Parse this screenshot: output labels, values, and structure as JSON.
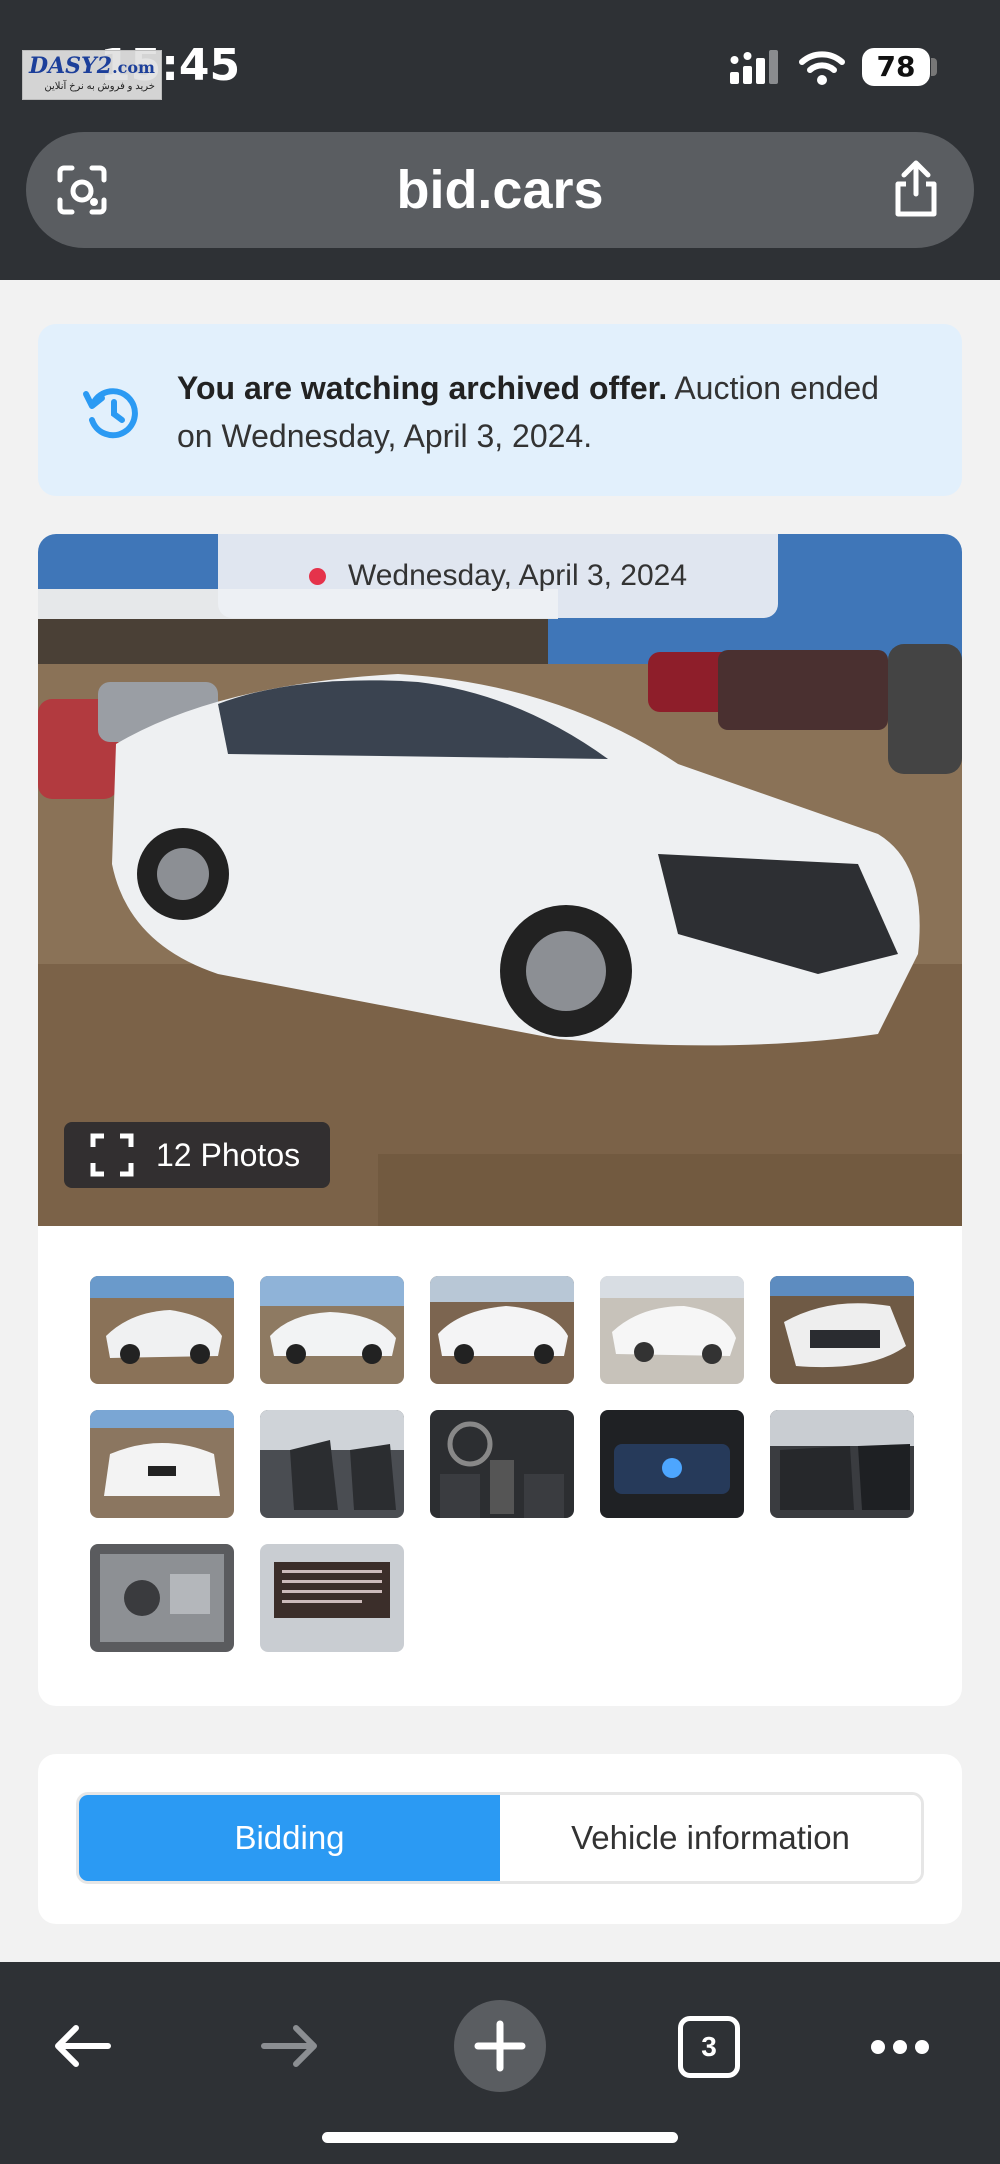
{
  "status_bar": {
    "time": "15:45",
    "battery": "78",
    "watermark": {
      "logo": "DASY2",
      "logo_suffix": ".com",
      "tagline": "خرید و فروش به نرخ آنلاین"
    }
  },
  "url_bar": {
    "domain": "bid.cars",
    "left_icon": "lens-icon",
    "right_icon": "share-icon"
  },
  "notice": {
    "icon": "history-icon",
    "bold": "You are watching archived offer.",
    "text": " Auction ended on Wednesday, April 3, 2024."
  },
  "gallery": {
    "auction_date": "Wednesday, April 3, 2024",
    "photos_label": "12 Photos",
    "thumbnails": [
      {
        "name": "thumb-1",
        "kind": "front-damage"
      },
      {
        "name": "thumb-2",
        "kind": "side"
      },
      {
        "name": "thumb-3",
        "kind": "rear-side"
      },
      {
        "name": "thumb-4",
        "kind": "front-side"
      },
      {
        "name": "thumb-5",
        "kind": "front-close"
      },
      {
        "name": "thumb-6",
        "kind": "rear"
      },
      {
        "name": "thumb-7",
        "kind": "front-seats"
      },
      {
        "name": "thumb-8",
        "kind": "dashboard"
      },
      {
        "name": "thumb-9",
        "kind": "cluster"
      },
      {
        "name": "thumb-10",
        "kind": "rear-seats"
      },
      {
        "name": "thumb-11",
        "kind": "engine"
      },
      {
        "name": "thumb-12",
        "kind": "label"
      }
    ]
  },
  "tabs": [
    {
      "label": "Bidding",
      "active": true
    },
    {
      "label": "Vehicle information",
      "active": false
    }
  ],
  "toolbar": {
    "open_tabs": "3"
  },
  "colors": {
    "accent": "#2b9af3",
    "chrome": "#2e3135",
    "notice_bg": "#e2f0fc",
    "live_dot": "#e5334b"
  }
}
